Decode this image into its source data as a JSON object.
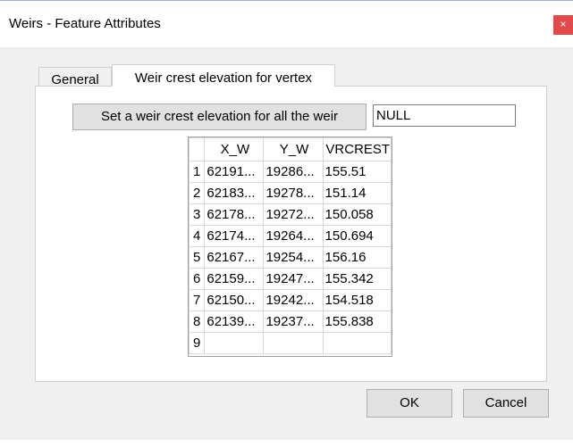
{
  "window": {
    "title": "Weirs - Feature Attributes",
    "close_glyph": "×"
  },
  "tabs": [
    {
      "label": "General"
    },
    {
      "label": "Weir crest elevation for vertex"
    }
  ],
  "set_button": {
    "label": "Set a weir crest elevation for all the weir"
  },
  "crest_value_field": {
    "value": "NULL"
  },
  "table": {
    "headers": [
      "X_W",
      "Y_W",
      "VRCREST"
    ],
    "rows": [
      {
        "num": "1",
        "x": "62191...",
        "y": "19286...",
        "v": "155.51"
      },
      {
        "num": "2",
        "x": "62183...",
        "y": "19278...",
        "v": "151.14"
      },
      {
        "num": "3",
        "x": "62178...",
        "y": "19272...",
        "v": "150.058"
      },
      {
        "num": "4",
        "x": "62174...",
        "y": "19264...",
        "v": "150.694"
      },
      {
        "num": "5",
        "x": "62167...",
        "y": "19254...",
        "v": "156.16"
      },
      {
        "num": "6",
        "x": "62159...",
        "y": "19247...",
        "v": "155.342"
      },
      {
        "num": "7",
        "x": "62150...",
        "y": "19242...",
        "v": "154.518"
      },
      {
        "num": "8",
        "x": "62139...",
        "y": "19237...",
        "v": "155.838"
      },
      {
        "num": "9",
        "x": "",
        "y": "",
        "v": ""
      }
    ]
  },
  "buttons": {
    "ok": "OK",
    "cancel": "Cancel"
  },
  "colors": {
    "close_button": "#e04a4a",
    "dialog_bg": "#f0f0f0"
  }
}
